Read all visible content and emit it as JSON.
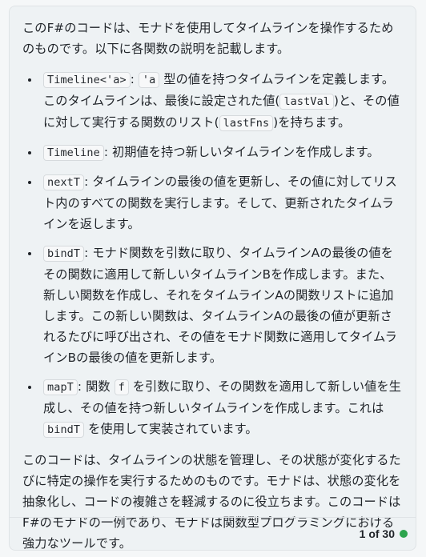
{
  "intro": "このF#のコードは、モナドを使用してタイムラインを操作するためのものです。以下に各関数の説明を記載します。",
  "items": [
    {
      "segs": [
        {
          "t": "code",
          "v": "Timeline<'a>"
        },
        {
          "t": "text",
          "v": ": "
        },
        {
          "t": "code",
          "v": "'a"
        },
        {
          "t": "text",
          "v": " 型の値を持つタイムラインを定義します。このタイムラインは、最後に設定された値("
        },
        {
          "t": "code",
          "v": "lastVal"
        },
        {
          "t": "text",
          "v": ")と、その値に対して実行する関数のリスト("
        },
        {
          "t": "code",
          "v": "lastFns"
        },
        {
          "t": "text",
          "v": ")を持ちます。"
        }
      ]
    },
    {
      "segs": [
        {
          "t": "code",
          "v": "Timeline"
        },
        {
          "t": "text",
          "v": ": 初期値を持つ新しいタイムラインを作成します。"
        }
      ]
    },
    {
      "segs": [
        {
          "t": "code",
          "v": "nextT"
        },
        {
          "t": "text",
          "v": ": タイムラインの最後の値を更新し、その値に対してリスト内のすべての関数を実行します。そして、更新されたタイムラインを返します。"
        }
      ]
    },
    {
      "segs": [
        {
          "t": "code",
          "v": "bindT"
        },
        {
          "t": "text",
          "v": ": モナド関数を引数に取り、タイムラインAの最後の値をその関数に適用して新しいタイムラインBを作成します。また、新しい関数を作成し、それをタイムラインAの関数リストに追加します。この新しい関数は、タイムラインAの最後の値が更新されるたびに呼び出され、その値をモナド関数に適用してタイムラインBの最後の値を更新します。"
        }
      ]
    },
    {
      "segs": [
        {
          "t": "code",
          "v": "mapT"
        },
        {
          "t": "text",
          "v": ": 関数 "
        },
        {
          "t": "code",
          "v": "f"
        },
        {
          "t": "text",
          "v": " を引数に取り、その関数を適用して新しい値を生成し、その値を持つ新しいタイムラインを作成します。これは "
        },
        {
          "t": "code",
          "v": "bindT"
        },
        {
          "t": "text",
          "v": " を使用して実装されています。"
        }
      ]
    }
  ],
  "outro": "このコードは、タイムラインの状態を管理し、その状態が変化するたびに特定の操作を実行するためのものです。モナドは、状態の変化を抽象化し、コードの複雑さを軽減するのに役立ちます。このコードはF#のモナドの一例であり、モナドは関数型プログラミングにおける強力なツールです。",
  "footer": {
    "pager": "1 of 30",
    "status_color": "#2da44e"
  }
}
